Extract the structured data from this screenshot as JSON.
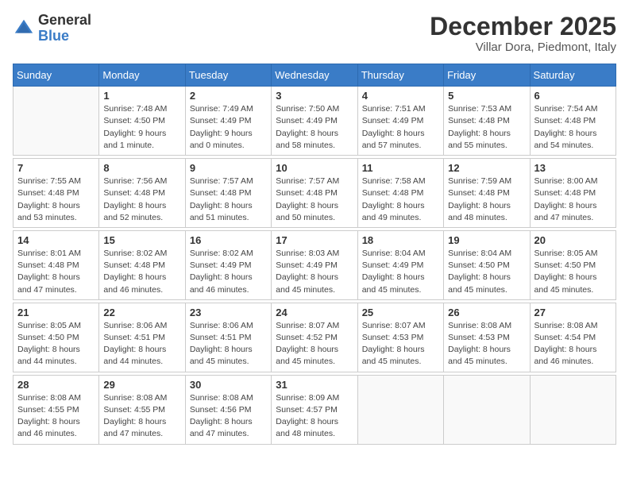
{
  "logo": {
    "general": "General",
    "blue": "Blue"
  },
  "header": {
    "month": "December 2025",
    "location": "Villar Dora, Piedmont, Italy"
  },
  "weekdays": [
    "Sunday",
    "Monday",
    "Tuesday",
    "Wednesday",
    "Thursday",
    "Friday",
    "Saturday"
  ],
  "weeks": [
    [
      {
        "day": "",
        "sunrise": "",
        "sunset": "",
        "daylight": ""
      },
      {
        "day": "1",
        "sunrise": "Sunrise: 7:48 AM",
        "sunset": "Sunset: 4:50 PM",
        "daylight": "Daylight: 9 hours and 1 minute."
      },
      {
        "day": "2",
        "sunrise": "Sunrise: 7:49 AM",
        "sunset": "Sunset: 4:49 PM",
        "daylight": "Daylight: 9 hours and 0 minutes."
      },
      {
        "day": "3",
        "sunrise": "Sunrise: 7:50 AM",
        "sunset": "Sunset: 4:49 PM",
        "daylight": "Daylight: 8 hours and 58 minutes."
      },
      {
        "day": "4",
        "sunrise": "Sunrise: 7:51 AM",
        "sunset": "Sunset: 4:49 PM",
        "daylight": "Daylight: 8 hours and 57 minutes."
      },
      {
        "day": "5",
        "sunrise": "Sunrise: 7:53 AM",
        "sunset": "Sunset: 4:48 PM",
        "daylight": "Daylight: 8 hours and 55 minutes."
      },
      {
        "day": "6",
        "sunrise": "Sunrise: 7:54 AM",
        "sunset": "Sunset: 4:48 PM",
        "daylight": "Daylight: 8 hours and 54 minutes."
      }
    ],
    [
      {
        "day": "7",
        "sunrise": "Sunrise: 7:55 AM",
        "sunset": "Sunset: 4:48 PM",
        "daylight": "Daylight: 8 hours and 53 minutes."
      },
      {
        "day": "8",
        "sunrise": "Sunrise: 7:56 AM",
        "sunset": "Sunset: 4:48 PM",
        "daylight": "Daylight: 8 hours and 52 minutes."
      },
      {
        "day": "9",
        "sunrise": "Sunrise: 7:57 AM",
        "sunset": "Sunset: 4:48 PM",
        "daylight": "Daylight: 8 hours and 51 minutes."
      },
      {
        "day": "10",
        "sunrise": "Sunrise: 7:57 AM",
        "sunset": "Sunset: 4:48 PM",
        "daylight": "Daylight: 8 hours and 50 minutes."
      },
      {
        "day": "11",
        "sunrise": "Sunrise: 7:58 AM",
        "sunset": "Sunset: 4:48 PM",
        "daylight": "Daylight: 8 hours and 49 minutes."
      },
      {
        "day": "12",
        "sunrise": "Sunrise: 7:59 AM",
        "sunset": "Sunset: 4:48 PM",
        "daylight": "Daylight: 8 hours and 48 minutes."
      },
      {
        "day": "13",
        "sunrise": "Sunrise: 8:00 AM",
        "sunset": "Sunset: 4:48 PM",
        "daylight": "Daylight: 8 hours and 47 minutes."
      }
    ],
    [
      {
        "day": "14",
        "sunrise": "Sunrise: 8:01 AM",
        "sunset": "Sunset: 4:48 PM",
        "daylight": "Daylight: 8 hours and 47 minutes."
      },
      {
        "day": "15",
        "sunrise": "Sunrise: 8:02 AM",
        "sunset": "Sunset: 4:48 PM",
        "daylight": "Daylight: 8 hours and 46 minutes."
      },
      {
        "day": "16",
        "sunrise": "Sunrise: 8:02 AM",
        "sunset": "Sunset: 4:49 PM",
        "daylight": "Daylight: 8 hours and 46 minutes."
      },
      {
        "day": "17",
        "sunrise": "Sunrise: 8:03 AM",
        "sunset": "Sunset: 4:49 PM",
        "daylight": "Daylight: 8 hours and 45 minutes."
      },
      {
        "day": "18",
        "sunrise": "Sunrise: 8:04 AM",
        "sunset": "Sunset: 4:49 PM",
        "daylight": "Daylight: 8 hours and 45 minutes."
      },
      {
        "day": "19",
        "sunrise": "Sunrise: 8:04 AM",
        "sunset": "Sunset: 4:50 PM",
        "daylight": "Daylight: 8 hours and 45 minutes."
      },
      {
        "day": "20",
        "sunrise": "Sunrise: 8:05 AM",
        "sunset": "Sunset: 4:50 PM",
        "daylight": "Daylight: 8 hours and 45 minutes."
      }
    ],
    [
      {
        "day": "21",
        "sunrise": "Sunrise: 8:05 AM",
        "sunset": "Sunset: 4:50 PM",
        "daylight": "Daylight: 8 hours and 44 minutes."
      },
      {
        "day": "22",
        "sunrise": "Sunrise: 8:06 AM",
        "sunset": "Sunset: 4:51 PM",
        "daylight": "Daylight: 8 hours and 44 minutes."
      },
      {
        "day": "23",
        "sunrise": "Sunrise: 8:06 AM",
        "sunset": "Sunset: 4:51 PM",
        "daylight": "Daylight: 8 hours and 45 minutes."
      },
      {
        "day": "24",
        "sunrise": "Sunrise: 8:07 AM",
        "sunset": "Sunset: 4:52 PM",
        "daylight": "Daylight: 8 hours and 45 minutes."
      },
      {
        "day": "25",
        "sunrise": "Sunrise: 8:07 AM",
        "sunset": "Sunset: 4:53 PM",
        "daylight": "Daylight: 8 hours and 45 minutes."
      },
      {
        "day": "26",
        "sunrise": "Sunrise: 8:08 AM",
        "sunset": "Sunset: 4:53 PM",
        "daylight": "Daylight: 8 hours and 45 minutes."
      },
      {
        "day": "27",
        "sunrise": "Sunrise: 8:08 AM",
        "sunset": "Sunset: 4:54 PM",
        "daylight": "Daylight: 8 hours and 46 minutes."
      }
    ],
    [
      {
        "day": "28",
        "sunrise": "Sunrise: 8:08 AM",
        "sunset": "Sunset: 4:55 PM",
        "daylight": "Daylight: 8 hours and 46 minutes."
      },
      {
        "day": "29",
        "sunrise": "Sunrise: 8:08 AM",
        "sunset": "Sunset: 4:55 PM",
        "daylight": "Daylight: 8 hours and 47 minutes."
      },
      {
        "day": "30",
        "sunrise": "Sunrise: 8:08 AM",
        "sunset": "Sunset: 4:56 PM",
        "daylight": "Daylight: 8 hours and 47 minutes."
      },
      {
        "day": "31",
        "sunrise": "Sunrise: 8:09 AM",
        "sunset": "Sunset: 4:57 PM",
        "daylight": "Daylight: 8 hours and 48 minutes."
      },
      {
        "day": "",
        "sunrise": "",
        "sunset": "",
        "daylight": ""
      },
      {
        "day": "",
        "sunrise": "",
        "sunset": "",
        "daylight": ""
      },
      {
        "day": "",
        "sunrise": "",
        "sunset": "",
        "daylight": ""
      }
    ]
  ]
}
